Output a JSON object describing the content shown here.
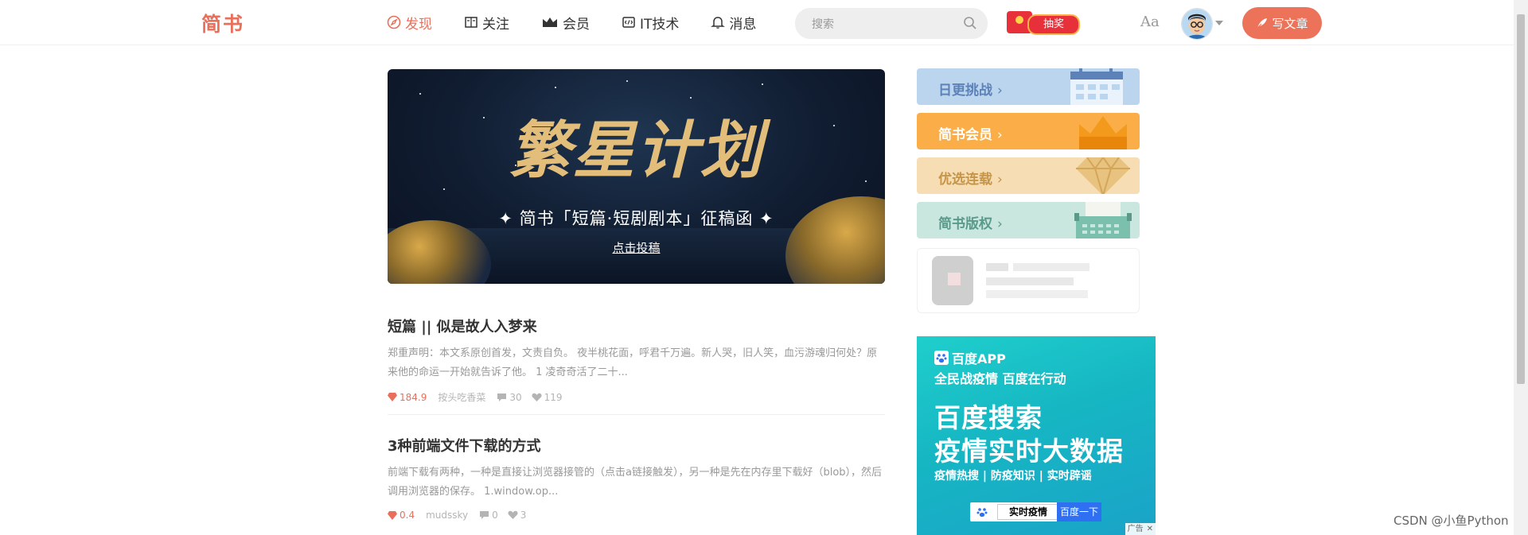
{
  "header": {
    "logo": "简书",
    "nav": [
      {
        "label": "发现",
        "icon": "compass-icon",
        "active": true
      },
      {
        "label": "关注",
        "icon": "book-icon",
        "active": false
      },
      {
        "label": "会员",
        "icon": "crown-icon",
        "active": false
      },
      {
        "label": "IT技术",
        "icon": "code-icon",
        "active": false
      },
      {
        "label": "消息",
        "icon": "bell-icon",
        "active": false
      }
    ],
    "search_placeholder": "搜索",
    "lottery_label": "抽奖",
    "font_toggle": "Aa",
    "write_label": "写文章"
  },
  "banner": {
    "title": "繁星计划",
    "subtitle": "✦ 简书「短篇·短剧剧本」征稿函 ✦",
    "cta": "点击投稿"
  },
  "articles": [
    {
      "title": "短篇 || 似是故人入梦来",
      "abstract": "郑重声明：本文系原创首发，文责自负。 夜半桃花面，呼君千万遍。新人哭，旧人笑，血污游魂归何处？原来他的命运一开始就告诉了他。 1 凌奇奇活了二十...",
      "diamonds": "184.9",
      "author": "按头吃香菜",
      "comments": "30",
      "likes": "119"
    },
    {
      "title": "3种前端文件下载的方式",
      "abstract": "前端下载有两种，一种是直接让浏览器接管的（点击a链接触发），另一种是先在内存里下载好（blob），然后调用浏览器的保存。 1.window.op...",
      "diamonds": "0.4",
      "author": "mudssky",
      "comments": "0",
      "likes": "3"
    }
  ],
  "sidebar": {
    "boards": [
      {
        "label": "日更挑战",
        "icon": "calendar-icon"
      },
      {
        "label": "简书会员",
        "icon": "crown-icon"
      },
      {
        "label": "优选连载",
        "icon": "diamond-icon"
      },
      {
        "label": "简书版权",
        "icon": "typewriter-icon"
      }
    ]
  },
  "ad": {
    "app": "百度APP",
    "tagline": "全民战疫情 百度在行动",
    "headline1": "百度搜索",
    "headline2": "疫情实时大数据",
    "keywords": "疫情热搜 | 防疫知识 | 实时辟谣",
    "search_query": "实时疫情",
    "search_button": "百度一下",
    "badge": "广告"
  },
  "watermark": "CSDN @小鱼Python",
  "colors": {
    "accent": "#ea6f5a",
    "write_button": "#ec7259"
  }
}
